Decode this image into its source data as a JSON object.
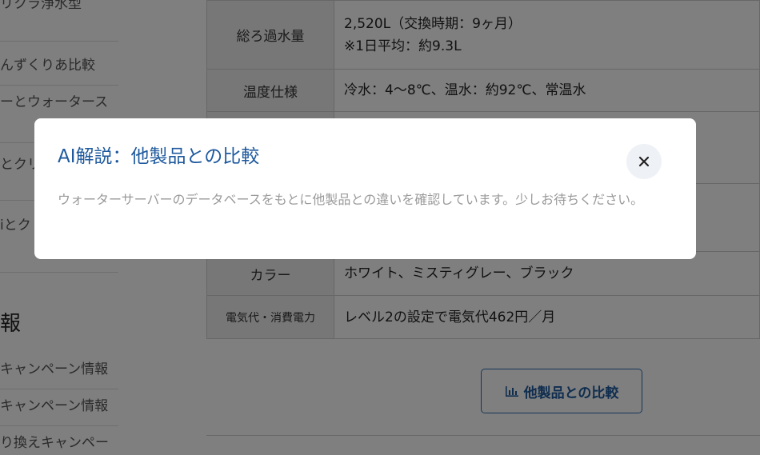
{
  "sidebar": {
    "links": [
      "リクラ浄水型",
      "んずくりあ比較",
      "ーとウォータース",
      "とクリ",
      "iとク",
      ""
    ],
    "heading": "報",
    "campaign_links": [
      "キャンペーン情報",
      "キャンペーン情報",
      "り換えキャンペー"
    ]
  },
  "spec_rows": [
    {
      "label": "総ろ過水量",
      "value_line1": "2,520L（交換時期：9ヶ月）",
      "value_line2": "※1日平均：約9.3L"
    },
    {
      "label": "温度仕様",
      "value_line1": "冷水：4〜8℃、温水：約92℃、常温水"
    },
    {
      "label": "",
      "value_line1": ""
    },
    {
      "label": "",
      "value_line1": ""
    },
    {
      "label": "カラー",
      "value_line1": "ホワイト、ミスティグレー、ブラック"
    },
    {
      "label": "電気代・消費電力",
      "value_line1": "レベル2の設定で電気代462円／月"
    }
  ],
  "compare_button": {
    "label": "他製品との比較",
    "icon": "bar-chart-icon"
  },
  "modal": {
    "title": "AI解説：他製品との比較",
    "message": "ウォーターサーバーのデータベースをもとに他製品との違いを確認しています。少しお待ちください。",
    "close_icon": "close-icon"
  },
  "colors": {
    "accent": "#1f5a9e",
    "overlay": "rgba(0,0,0,0.5)",
    "label_bg": "#eeeeee"
  }
}
